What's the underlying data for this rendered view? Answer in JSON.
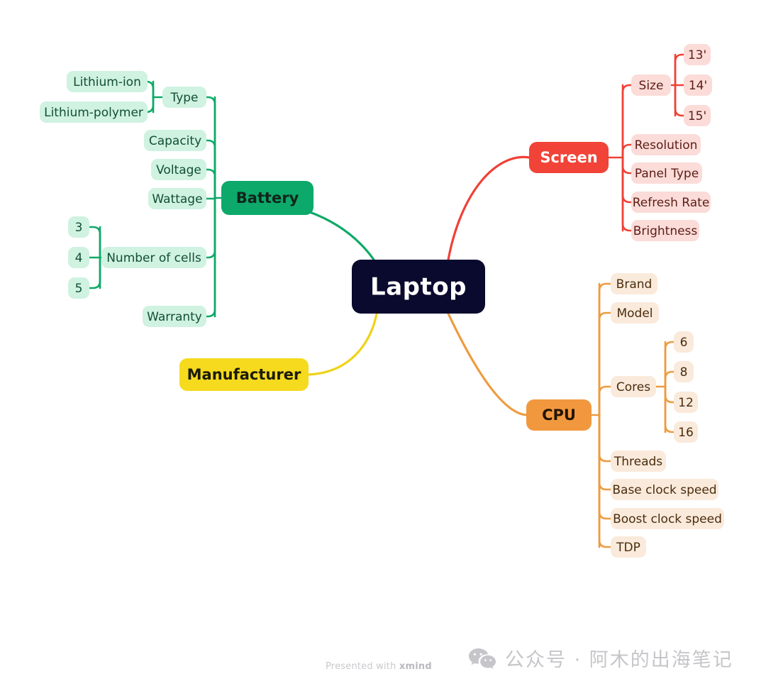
{
  "diagram": {
    "type": "mind-map",
    "root": {
      "label": "Laptop",
      "color": "#0a0a2e",
      "text_color": "#ffffff"
    },
    "branches": [
      {
        "id": "battery",
        "label": "Battery",
        "side": "left",
        "color": "#0FA968",
        "node_fill": "#0CA96A",
        "node_text": "#11241b",
        "chip_fill": "#CFF2E1",
        "chip_text": "#134e35",
        "children": [
          {
            "label": "Type",
            "children": [
              {
                "label": "Lithium-ion"
              },
              {
                "label": "Lithium-polymer"
              }
            ]
          },
          {
            "label": "Capacity",
            "children": []
          },
          {
            "label": "Voltage",
            "children": []
          },
          {
            "label": "Wattage",
            "children": []
          },
          {
            "label": "Number of cells",
            "children": [
              {
                "label": "3"
              },
              {
                "label": "4"
              },
              {
                "label": "5"
              }
            ]
          },
          {
            "label": "Warranty",
            "children": []
          }
        ]
      },
      {
        "id": "manufacturer",
        "label": "Manufacturer",
        "side": "left",
        "color": "#EFD317",
        "node_fill": "#F5DA1E",
        "node_text": "#1b1b08",
        "chip_fill": "#FAF0B4",
        "chip_text": "#4a4410",
        "children": []
      },
      {
        "id": "screen",
        "label": "Screen",
        "side": "right",
        "color": "#EF4136",
        "node_fill": "#F14337",
        "node_text": "#ffffff",
        "chip_fill": "#FBDCD8",
        "chip_text": "#5c1d17",
        "children": [
          {
            "label": "Size",
            "children": [
              {
                "label": "13'"
              },
              {
                "label": "14'"
              },
              {
                "label": "15'"
              }
            ]
          },
          {
            "label": "Resolution",
            "children": []
          },
          {
            "label": "Panel Type",
            "children": []
          },
          {
            "label": "Refresh Rate",
            "children": []
          },
          {
            "label": "Brightness",
            "children": []
          }
        ]
      },
      {
        "id": "cpu",
        "label": "CPU",
        "side": "right",
        "color": "#EE9A3F",
        "node_fill": "#F1983F",
        "node_text": "#241403",
        "chip_fill": "#FAEADB",
        "chip_text": "#4a2c0e",
        "children": [
          {
            "label": "Brand",
            "children": []
          },
          {
            "label": "Model",
            "children": []
          },
          {
            "label": "Cores",
            "children": [
              {
                "label": "6"
              },
              {
                "label": "8"
              },
              {
                "label": "12"
              },
              {
                "label": "16"
              }
            ]
          },
          {
            "label": "Threads",
            "children": []
          },
          {
            "label": "Base clock speed",
            "children": []
          },
          {
            "label": "Boost clock speed",
            "children": []
          },
          {
            "label": "TDP",
            "children": []
          }
        ]
      }
    ]
  },
  "footer": {
    "xmind_prefix": "Presented with ",
    "xmind_brand": "xmind",
    "wechat_icon": "wechat-icon",
    "wechat_label": "公众号 · 阿木的出海笔记"
  }
}
